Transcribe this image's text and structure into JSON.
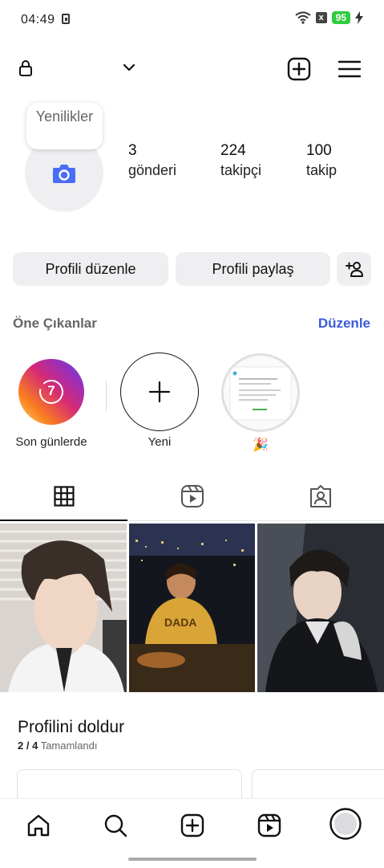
{
  "status_bar": {
    "time": "04:49",
    "battery": "95",
    "x_badge": "x"
  },
  "header": {
    "lock_icon": "lock-icon",
    "chevron_icon": "chevron-down-icon",
    "create_icon": "plus-square-icon",
    "menu_icon": "hamburger-menu-icon"
  },
  "profile": {
    "tooltip": "Yenilikler",
    "posts_count": "3",
    "posts_label": "gönderi",
    "followers_count": "224",
    "followers_label": "takipçi",
    "following_count": "100",
    "following_label": "takip"
  },
  "actions": {
    "edit_label": "Profili düzenle",
    "share_label": "Profili paylaş",
    "add_person_icon": "add-person-icon"
  },
  "highlights": {
    "title": "Öne Çıkanlar",
    "edit_link": "Düzenle",
    "items": [
      {
        "label": "Son günlerde",
        "badge": "7"
      },
      {
        "label": "Yeni"
      },
      {
        "label": "🎉"
      }
    ]
  },
  "tabs": [
    {
      "icon": "grid-icon",
      "active": true
    },
    {
      "icon": "reels-icon",
      "active": false
    },
    {
      "icon": "tagged-icon",
      "active": false
    }
  ],
  "complete_profile": {
    "title": "Profilini doldur",
    "progress": "2 / 4",
    "progress_label": "Tamamlandı"
  },
  "bottom_nav": [
    "home-icon",
    "search-icon",
    "create-icon",
    "reels-icon",
    "profile-avatar"
  ],
  "colors": {
    "accent": "#3b5bdb",
    "button_bg": "#efeff2",
    "battery": "#2ecc40"
  }
}
